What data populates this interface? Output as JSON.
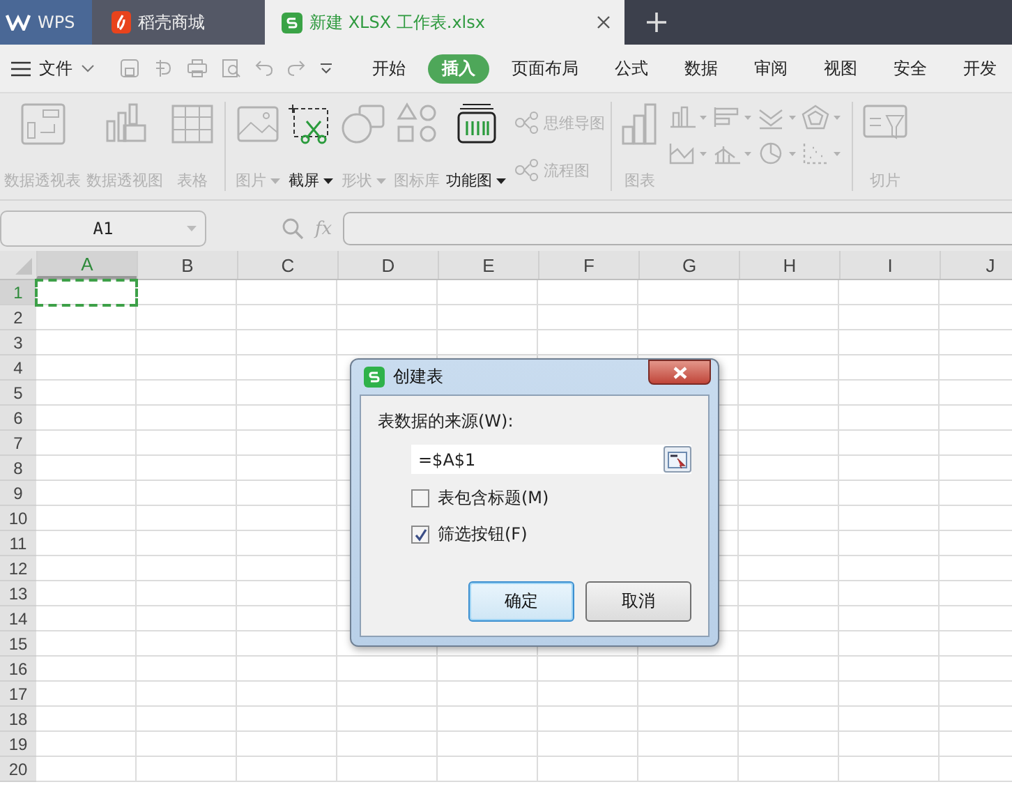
{
  "tabs": [
    {
      "label": "WPS",
      "kind": "home",
      "selected": false
    },
    {
      "label": "稻壳商城",
      "kind": "store",
      "selected": false
    },
    {
      "label": "新建 XLSX 工作表.xlsx",
      "kind": "sheet",
      "selected": true
    }
  ],
  "menu": {
    "file": "文件",
    "items": [
      {
        "label": "开始",
        "selected": false
      },
      {
        "label": "插入",
        "selected": true
      },
      {
        "label": "页面布局",
        "selected": false
      },
      {
        "label": "公式",
        "selected": false
      },
      {
        "label": "数据",
        "selected": false
      },
      {
        "label": "审阅",
        "selected": false
      },
      {
        "label": "视图",
        "selected": false
      },
      {
        "label": "安全",
        "selected": false
      },
      {
        "label": "开发",
        "selected": false
      }
    ]
  },
  "ribbon": [
    {
      "items": [
        {
          "kind": "large",
          "label": "数据透视表",
          "disabled": true
        },
        {
          "kind": "large",
          "label": "数据透视图",
          "disabled": true
        },
        {
          "kind": "large",
          "label": "表格",
          "disabled": true
        }
      ]
    },
    {
      "items": [
        {
          "kind": "large",
          "label": "图片",
          "disabled": true,
          "dropdown": true
        },
        {
          "kind": "large",
          "label": "截屏",
          "disabled": false,
          "dropdown": true
        },
        {
          "kind": "large",
          "label": "形状",
          "disabled": true,
          "dropdown": true
        },
        {
          "kind": "large",
          "label": "图标库",
          "disabled": true
        },
        {
          "kind": "large",
          "label": "功能图",
          "disabled": false,
          "dropdown": true
        }
      ],
      "stack": [
        {
          "label": "思维导图",
          "disabled": true
        },
        {
          "label": "流程图",
          "disabled": true
        }
      ]
    },
    {
      "items": [
        {
          "kind": "charts",
          "label": "图表",
          "disabled": true
        }
      ]
    },
    {
      "items": [
        {
          "kind": "large",
          "label": "切片",
          "disabled": true
        }
      ]
    }
  ],
  "formula_bar": {
    "name_box": "A1",
    "fx": "fx"
  },
  "sheet": {
    "columns": [
      {
        "label": "A",
        "selected": true
      },
      {
        "label": "B",
        "selected": false
      },
      {
        "label": "C",
        "selected": false
      },
      {
        "label": "D",
        "selected": false
      },
      {
        "label": "E",
        "selected": false
      },
      {
        "label": "F",
        "selected": false
      },
      {
        "label": "G",
        "selected": false
      },
      {
        "label": "H",
        "selected": false
      },
      {
        "label": "I",
        "selected": false
      },
      {
        "label": "J",
        "selected": false
      }
    ],
    "rows": [
      {
        "label": "1",
        "selected": true
      },
      {
        "label": "2",
        "selected": false
      },
      {
        "label": "3",
        "selected": false
      },
      {
        "label": "4",
        "selected": false
      },
      {
        "label": "5",
        "selected": false
      },
      {
        "label": "6",
        "selected": false
      },
      {
        "label": "7",
        "selected": false
      },
      {
        "label": "8",
        "selected": false
      },
      {
        "label": "9",
        "selected": false
      },
      {
        "label": "10",
        "selected": false
      },
      {
        "label": "11",
        "selected": false
      },
      {
        "label": "12",
        "selected": false
      },
      {
        "label": "13",
        "selected": false
      },
      {
        "label": "14",
        "selected": false
      },
      {
        "label": "15",
        "selected": false
      },
      {
        "label": "16",
        "selected": false
      },
      {
        "label": "17",
        "selected": false
      },
      {
        "label": "18",
        "selected": false
      },
      {
        "label": "19",
        "selected": false
      },
      {
        "label": "20",
        "selected": false
      }
    ]
  },
  "dialog": {
    "title": "创建表",
    "source_label": "表数据的来源(W):",
    "source_value": "=$A$1",
    "checkboxes": [
      {
        "label": "表包含标题(M)",
        "checked": false
      },
      {
        "label": "筛选按钮(F)",
        "checked": true
      }
    ],
    "buttons": [
      {
        "label": "确定",
        "default": true
      },
      {
        "label": "取消",
        "default": false
      }
    ]
  }
}
